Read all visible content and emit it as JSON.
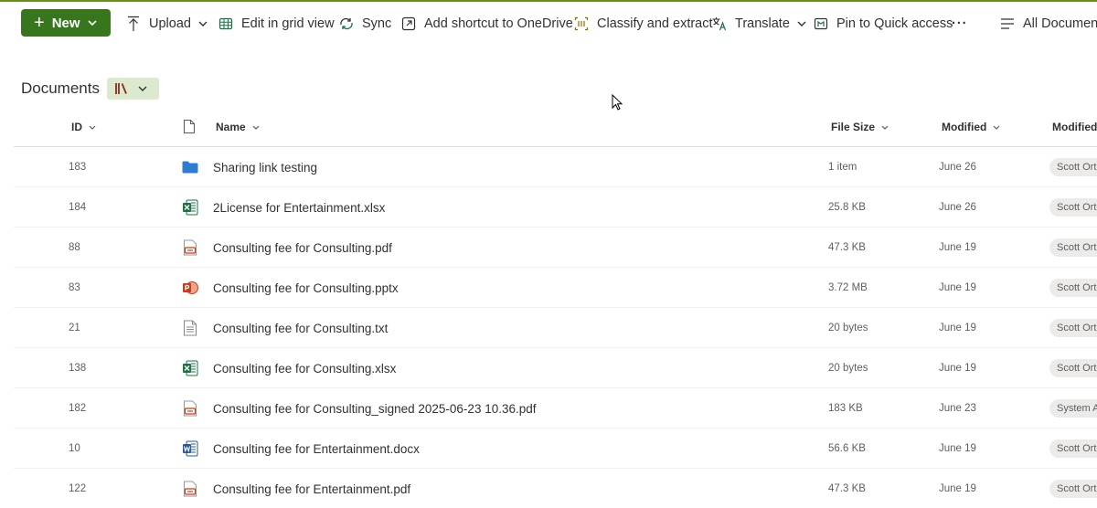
{
  "command_bar": {
    "new_label": "New",
    "upload_label": "Upload",
    "edit_grid_label": "Edit in grid view",
    "sync_label": "Sync",
    "shortcut_label": "Add shortcut to OneDrive",
    "classify_label": "Classify and extract",
    "translate_label": "Translate",
    "pin_label": "Pin to Quick access",
    "more_label": "···",
    "view_label": "All Documents"
  },
  "library": {
    "title": "Documents"
  },
  "columns": {
    "id": "ID",
    "name": "Name",
    "file_size": "File Size",
    "modified": "Modified",
    "modified_by": "Modified"
  },
  "rows": [
    {
      "id": "183",
      "icon": "folder",
      "name": "Sharing link testing",
      "size": "1 item",
      "modified": "June 26",
      "modified_by": "Scott Ort"
    },
    {
      "id": "184",
      "icon": "excel",
      "name": "2License for Entertainment.xlsx",
      "size": "25.8 KB",
      "modified": "June 26",
      "modified_by": "Scott Ort"
    },
    {
      "id": "88",
      "icon": "pdf",
      "name": "Consulting fee for Consulting.pdf",
      "size": "47.3 KB",
      "modified": "June 19",
      "modified_by": "Scott Ort"
    },
    {
      "id": "83",
      "icon": "powerpoint",
      "name": "Consulting fee for Consulting.pptx",
      "size": "3.72 MB",
      "modified": "June 19",
      "modified_by": "Scott Ort"
    },
    {
      "id": "21",
      "icon": "text",
      "name": "Consulting fee for Consulting.txt",
      "size": "20 bytes",
      "modified": "June 19",
      "modified_by": "Scott Ort"
    },
    {
      "id": "138",
      "icon": "excel",
      "name": "Consulting fee for Consulting.xlsx",
      "size": "20 bytes",
      "modified": "June 19",
      "modified_by": "Scott Ort"
    },
    {
      "id": "182",
      "icon": "pdf",
      "name": "Consulting fee for Consulting_signed 2025-06-23 10.36.pdf",
      "size": "183 KB",
      "modified": "June 23",
      "modified_by": "System A"
    },
    {
      "id": "10",
      "icon": "word",
      "name": "Consulting fee for Entertainment.docx",
      "size": "56.6 KB",
      "modified": "June 19",
      "modified_by": "Scott Ort"
    },
    {
      "id": "122",
      "icon": "pdf",
      "name": "Consulting fee for Entertainment.pdf",
      "size": "47.3 KB",
      "modified": "June 19",
      "modified_by": "Scott Ort"
    }
  ],
  "colors": {
    "accent": "#38761d",
    "accent_light": "#dbe9cf",
    "folder": "#2b7cd3",
    "excel": "#1d7044",
    "pdf": "#c43e1c",
    "powerpoint": "#c43e1c",
    "word": "#2b579a"
  }
}
